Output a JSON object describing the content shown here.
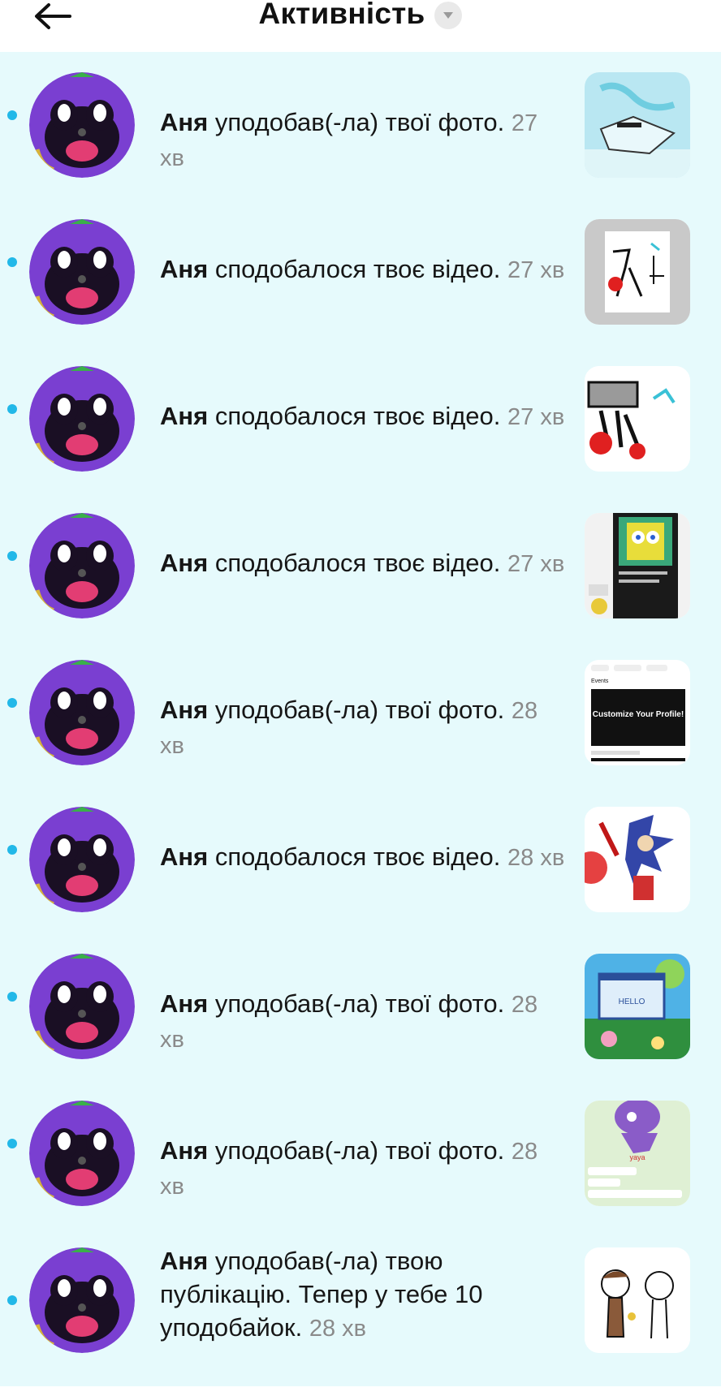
{
  "header": {
    "title": "Активність"
  },
  "notifications": [
    {
      "user": "Аня",
      "text": "уподобав(-ла) твої фото.",
      "time": "27 хв",
      "thumb": "thumb-blue-drawing"
    },
    {
      "user": "Аня",
      "text": "сподобалося твоє відео.",
      "time": "27 хв",
      "thumb": "thumb-sketch-gray"
    },
    {
      "user": "Аня",
      "text": "сподобалося твоє відео.",
      "time": "27 хв",
      "thumb": "thumb-sketch-red"
    },
    {
      "user": "Аня",
      "text": "сподобалося твоє відео.",
      "time": "27 хв",
      "thumb": "thumb-spongebob"
    },
    {
      "user": "Аня",
      "text": "уподобав(-ла) твої фото.",
      "time": "28 хв",
      "thumb": "thumb-events"
    },
    {
      "user": "Аня",
      "text": "сподобалося твоє відео.",
      "time": "28 хв",
      "thumb": "thumb-hedgehog"
    },
    {
      "user": "Аня",
      "text": "уподобав(-ла) твої фото.",
      "time": "28 хв",
      "thumb": "thumb-windows"
    },
    {
      "user": "Аня",
      "text": "уподобав(-ла) твої фото.",
      "time": "28 хв",
      "thumb": "thumb-purple-char"
    },
    {
      "user": "Аня",
      "text": "уподобав(-ла) твою публікацію. Тепер у тебе 10 уподобайок.",
      "time": "28 хв",
      "thumb": "thumb-two-figures"
    }
  ],
  "thumb_texts": {
    "events_label": "Events",
    "events_banner": "Customize Your Profile!",
    "hello": "HELLO",
    "yaya": "yaya"
  },
  "colors": {
    "list_bg": "#e6fafc",
    "unread_dot": "#22b8e8",
    "avatar_purple": "#7a3fd1"
  }
}
